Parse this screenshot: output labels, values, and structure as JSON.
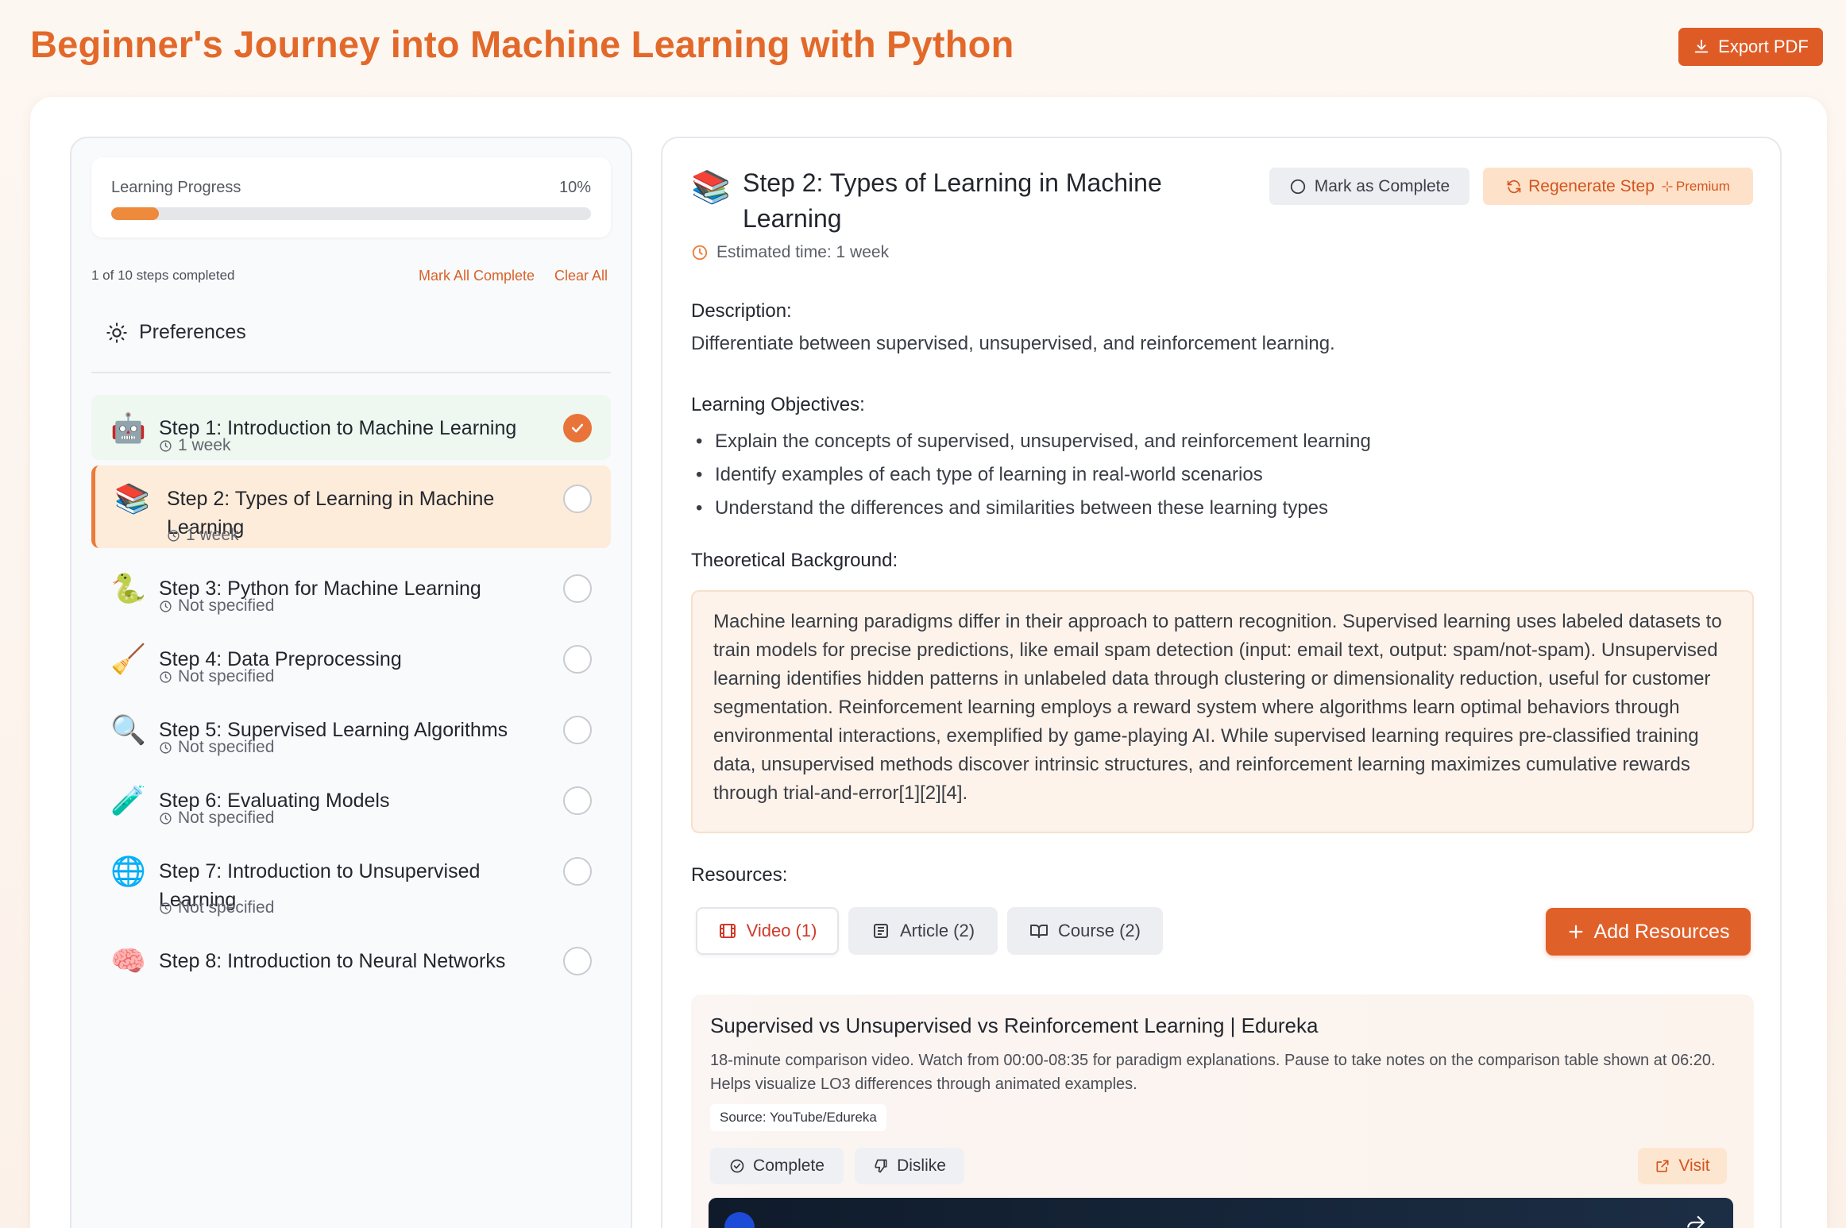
{
  "header": {
    "title": "Beginner's Journey into Machine Learning with Python",
    "export_label": "Export PDF"
  },
  "sidebar": {
    "progress_label": "Learning Progress",
    "progress_pct_text": "10%",
    "progress_fraction": 0.1,
    "steps_completed": "1 of 10 steps completed",
    "mark_all_label": "Mark All Complete",
    "clear_all_label": "Clear All",
    "preferences_label": "Preferences",
    "steps": [
      {
        "emoji": "🤖",
        "title": "Step 1: Introduction to Machine Learning",
        "duration": "1 week",
        "status": "done"
      },
      {
        "emoji": "📚",
        "title": "Step 2: Types of Learning in Machine Learning",
        "duration": "1 week",
        "status": "active"
      },
      {
        "emoji": "🐍",
        "title": "Step 3: Python for Machine Learning",
        "duration": "Not specified",
        "status": "todo"
      },
      {
        "emoji": "🧹",
        "title": "Step 4: Data Preprocessing",
        "duration": "Not specified",
        "status": "todo"
      },
      {
        "emoji": "🔍",
        "title": "Step 5: Supervised Learning Algorithms",
        "duration": "Not specified",
        "status": "todo"
      },
      {
        "emoji": "🧪",
        "title": "Step 6: Evaluating Models",
        "duration": "Not specified",
        "status": "todo"
      },
      {
        "emoji": "🌐",
        "title": "Step 7: Introduction to Unsupervised Learning",
        "duration": "Not specified",
        "status": "todo"
      },
      {
        "emoji": "🧠",
        "title": "Step 8: Introduction to Neural Networks",
        "duration": "",
        "status": "todo"
      }
    ]
  },
  "detail": {
    "emoji": "📚",
    "title": "Step 2: Types of Learning in Machine Learning",
    "estimated_time": "Estimated time: 1 week",
    "mark_complete_label": "Mark as Complete",
    "regenerate_label": "Regenerate Step",
    "premium_label": "Premium",
    "description_heading": "Description:",
    "description": "Differentiate between supervised, unsupervised, and reinforcement learning.",
    "objectives_heading": "Learning Objectives:",
    "objectives": [
      "Explain the concepts of supervised, unsupervised, and reinforcement learning",
      "Identify examples of each type of learning in real-world scenarios",
      "Understand the differences and similarities between these learning types"
    ],
    "theory_heading": "Theoretical Background:",
    "theory": "Machine learning paradigms differ in their approach to pattern recognition. Supervised learning uses labeled datasets to train models for precise predictions, like email spam detection (input: email text, output: spam/not-spam). Unsupervised learning identifies hidden patterns in unlabeled data through clustering or dimensionality reduction, useful for customer segmentation. Reinforcement learning employs a reward system where algorithms learn optimal behaviors through environmental interactions, exemplified by game-playing AI. While supervised learning requires pre-classified training data, unsupervised methods discover intrinsic structures, and reinforcement learning maximizes cumulative rewards through trial-and-error[1][2][4].",
    "resources_heading": "Resources:",
    "tabs": {
      "video": "Video (1)",
      "article": "Article (2)",
      "course": "Course (2)"
    },
    "add_resources_label": "Add Resources",
    "resource": {
      "title": "Supervised vs Unsupervised vs Reinforcement Learning | Edureka",
      "description": "18-minute comparison video. Watch from 00:00-08:35 for paradigm explanations. Pause to take notes on the comparison table shown at 06:20. Helps visualize LO3 differences through animated examples.",
      "source": "Source: YouTube/Edureka",
      "complete_label": "Complete",
      "dislike_label": "Dislike",
      "visit_label": "Visit"
    }
  },
  "colors": {
    "accent": "#e2692a",
    "button": "#df5b26",
    "active_step_bg": "#fdecd9",
    "done_step_bg": "#eef8f0"
  }
}
